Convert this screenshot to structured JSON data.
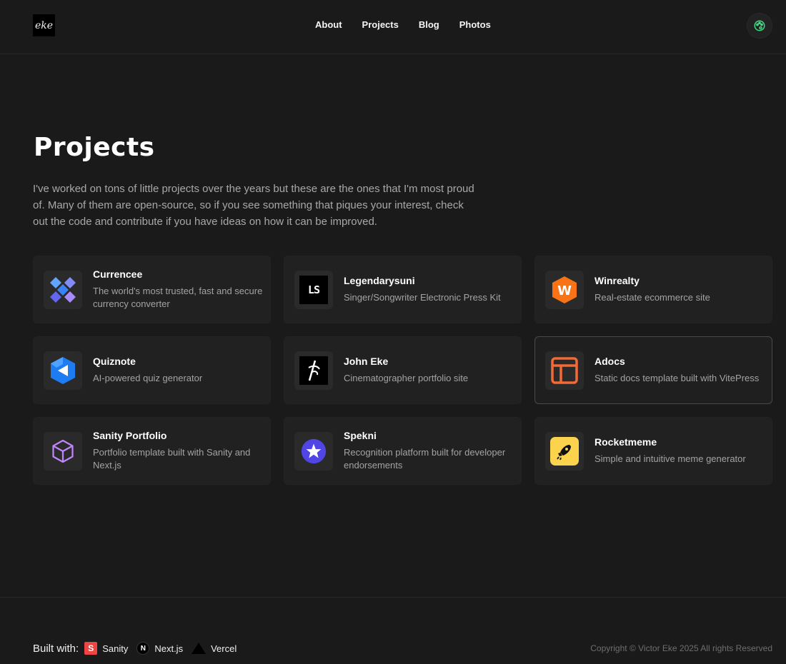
{
  "header": {
    "logo_text": "eke",
    "nav": [
      "About",
      "Projects",
      "Blog",
      "Photos"
    ],
    "theme_icon": "palette-icon"
  },
  "page": {
    "title": "Projects",
    "intro": "I've worked on tons of little projects over the years but these are the ones that I'm most proud of. Many of them are open-source, so if you see something that piques your interest, check out the code and contribute if you have ideas on how it can be improved."
  },
  "projects": [
    {
      "name": "Currencee",
      "desc": "The world's most trusted, fast and secure currency converter",
      "icon": "currencee-logo-icon"
    },
    {
      "name": "Legendarysuni",
      "desc": "Singer/Songwriter Electronic Press Kit",
      "icon": "ls-logo-icon",
      "logo_text": "LS"
    },
    {
      "name": "Winrealty",
      "desc": "Real-estate ecommerce site",
      "icon": "winrealty-logo-icon",
      "logo_text": "W"
    },
    {
      "name": "Quiznote",
      "desc": "AI-powered quiz generator",
      "icon": "quiznote-logo-icon"
    },
    {
      "name": "John Eke",
      "desc": "Cinematographer portfolio site",
      "icon": "john-eke-logo-icon"
    },
    {
      "name": "Adocs",
      "desc": "Static docs template built with VitePress",
      "icon": "adocs-logo-icon"
    },
    {
      "name": "Sanity Portfolio",
      "desc": "Portfolio template built with Sanity and Next.js",
      "icon": "cube-icon"
    },
    {
      "name": "Spekni",
      "desc": "Recognition platform built for developer endorsements",
      "icon": "spekni-star-icon"
    },
    {
      "name": "Rocketmeme",
      "desc": "Simple and intuitive meme generator",
      "icon": "rocket-icon"
    }
  ],
  "footer": {
    "built_with": "Built with:",
    "tech": [
      {
        "name": "Sanity",
        "icon": "sanity-icon",
        "logo_text": "S"
      },
      {
        "name": "Next.js",
        "icon": "nextjs-icon",
        "logo_text": "N"
      },
      {
        "name": "Vercel",
        "icon": "vercel-icon"
      }
    ],
    "copyright": "Copyright © Victor Eke 2025 All rights Reserved"
  }
}
